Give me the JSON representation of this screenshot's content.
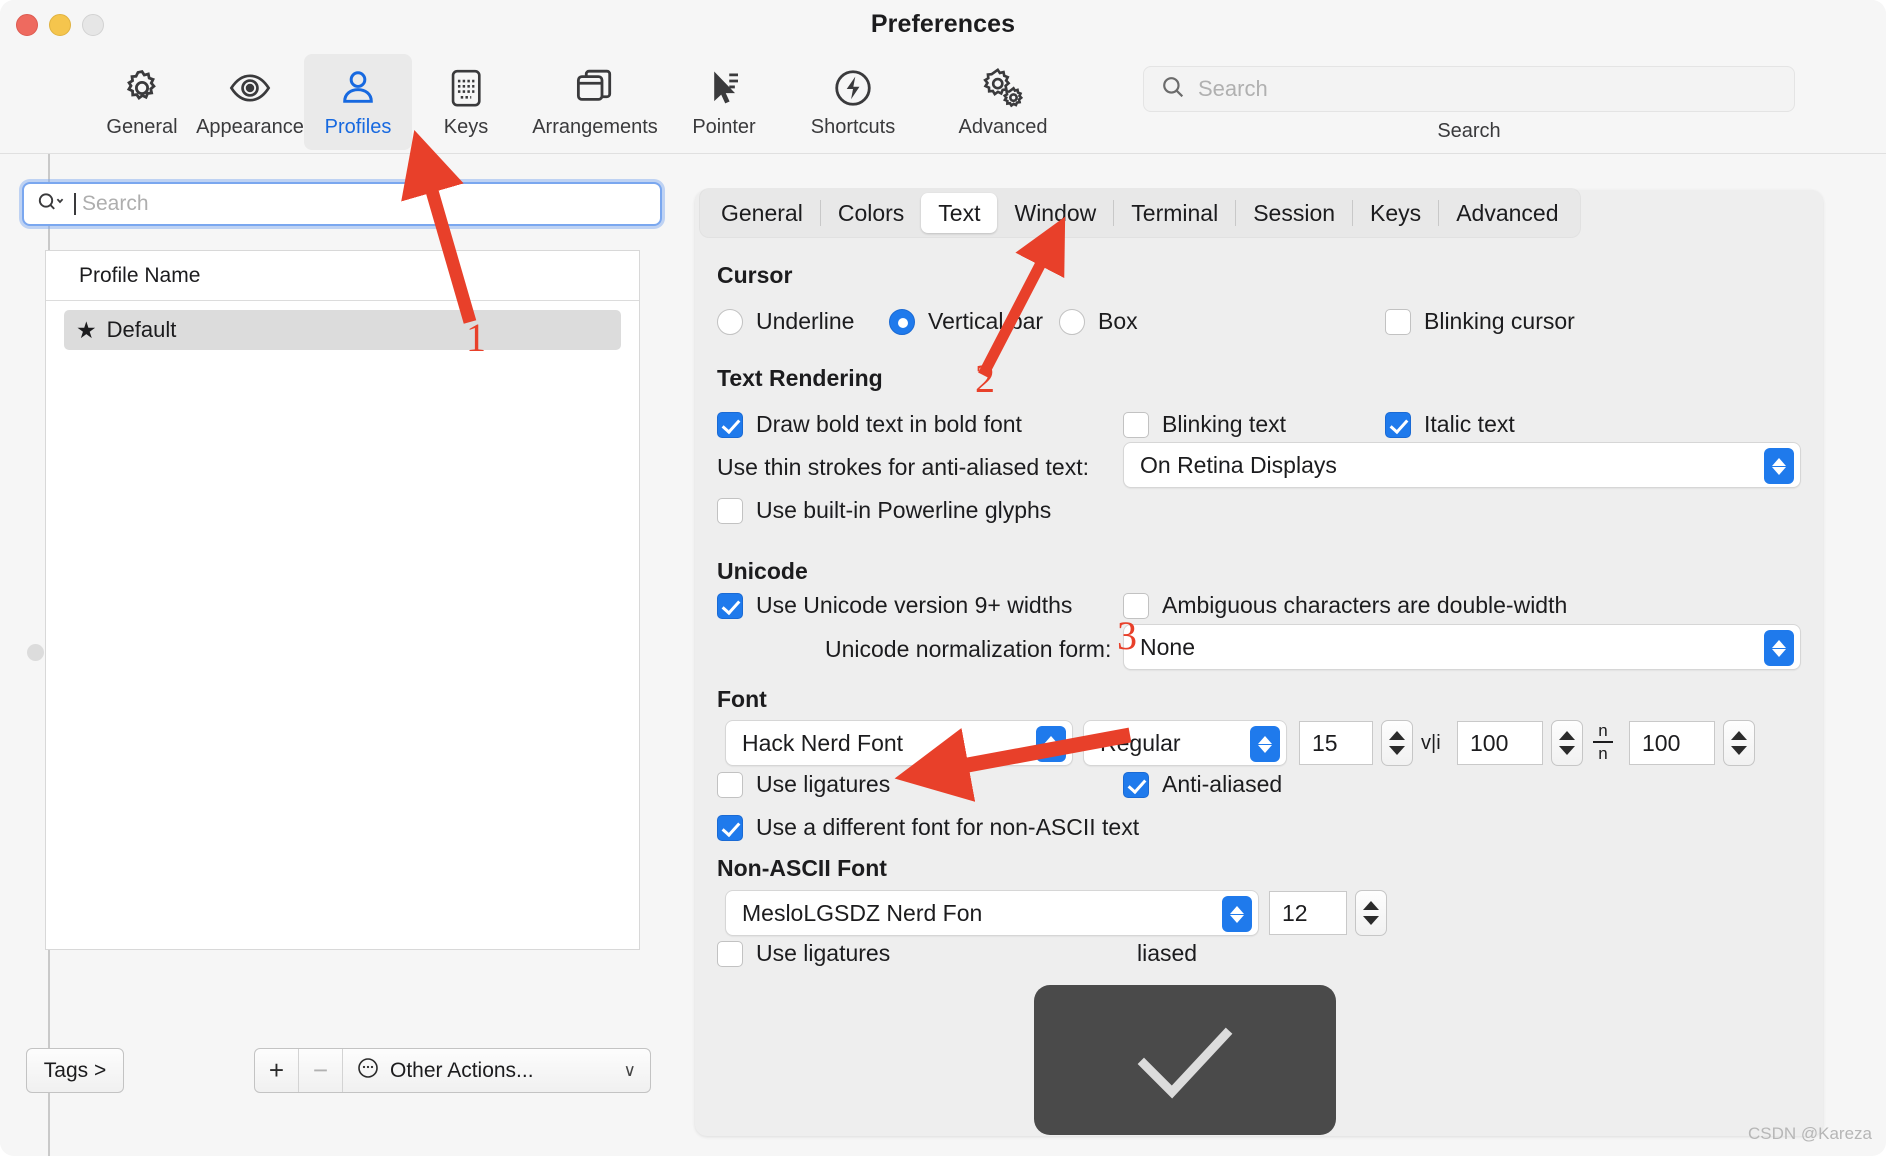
{
  "window": {
    "title": "Preferences",
    "traffic_lights": [
      "close",
      "minimize",
      "zoom"
    ]
  },
  "toolbar": {
    "items": [
      {
        "label": "General",
        "icon": "gear-icon"
      },
      {
        "label": "Appearance",
        "icon": "eye-icon"
      },
      {
        "label": "Profiles",
        "icon": "person-icon",
        "selected": true
      },
      {
        "label": "Keys",
        "icon": "keyboard-icon"
      },
      {
        "label": "Arrangements",
        "icon": "windows-icon"
      },
      {
        "label": "Pointer",
        "icon": "cursor-icon"
      },
      {
        "label": "Shortcuts",
        "icon": "bolt-icon"
      },
      {
        "label": "Advanced",
        "icon": "gears-icon"
      }
    ],
    "search": {
      "placeholder": "Search",
      "value": "",
      "label": "Search",
      "icon": "search-icon"
    }
  },
  "sidebar": {
    "search": {
      "placeholder": "Search",
      "value": "",
      "icon": "search-dropdown-icon"
    },
    "list": {
      "column_header": "Profile Name",
      "rows": [
        {
          "name": "Default",
          "starred": true,
          "selected": true
        }
      ]
    },
    "footer": {
      "tags_label": "Tags >",
      "add_label": "+",
      "remove_label": "−",
      "other_actions_label": "Other Actions...",
      "other_actions_icon": "ellipsis-circle-icon",
      "chevron": "∨"
    }
  },
  "tabs": [
    {
      "label": "General",
      "active": false
    },
    {
      "label": "Colors",
      "active": false
    },
    {
      "label": "Text",
      "active": true
    },
    {
      "label": "Window",
      "active": false
    },
    {
      "label": "Terminal",
      "active": false
    },
    {
      "label": "Session",
      "active": false
    },
    {
      "label": "Keys",
      "active": false
    },
    {
      "label": "Advanced",
      "active": false
    }
  ],
  "text_pane": {
    "cursor": {
      "heading": "Cursor",
      "options": [
        {
          "label": "Underline",
          "selected": false
        },
        {
          "label": "Vertical bar",
          "selected": true
        },
        {
          "label": "Box",
          "selected": false
        }
      ],
      "blinking_cursor": {
        "label": "Blinking cursor",
        "checked": false
      }
    },
    "text_rendering": {
      "heading": "Text Rendering",
      "draw_bold": {
        "label": "Draw bold text in bold font",
        "checked": true
      },
      "blinking_text": {
        "label": "Blinking text",
        "checked": false
      },
      "italic_text": {
        "label": "Italic text",
        "checked": true
      },
      "thin_strokes_label": "Use thin strokes for anti-aliased text:",
      "thin_strokes_value": "On Retina Displays",
      "powerline": {
        "label": "Use built-in Powerline glyphs",
        "checked": false
      }
    },
    "unicode": {
      "heading": "Unicode",
      "version9": {
        "label": "Use Unicode version 9+ widths",
        "checked": true
      },
      "ambiguous": {
        "label": "Ambiguous characters are double-width",
        "checked": false
      },
      "normalization_label": "Unicode normalization form:",
      "normalization_value": "None"
    },
    "font": {
      "heading": "Font",
      "family": "Hack Nerd Font",
      "weight": "Regular",
      "size": "15",
      "horizontal_spacing_icon": "v|i",
      "horizontal_spacing": "100",
      "vertical_spacing_icon": "n/n",
      "vertical_spacing": "100",
      "ligatures": {
        "label": "Use ligatures",
        "checked": false
      },
      "antialiased": {
        "label": "Anti-aliased",
        "checked": true
      },
      "different_nonascii": {
        "label": "Use a different font for non-ASCII text",
        "checked": true
      }
    },
    "nonascii_font": {
      "heading": "Non-ASCII Font",
      "family": "MesloLGSDZ Nerd Fon",
      "size": "12",
      "ligatures": {
        "label": "Use ligatures",
        "checked": false
      },
      "antialiased": {
        "label": "liased",
        "checked": true
      }
    }
  },
  "annotations": [
    {
      "number": "1",
      "target": "profiles-toolbar-item"
    },
    {
      "number": "2",
      "target": "text-tab"
    },
    {
      "number": "3",
      "target": "font-family-popup"
    }
  ],
  "hud": {
    "icon": "checkmark-icon"
  },
  "watermark": "CSDN @Kareza",
  "colors": {
    "accent_blue": "#1f7aec",
    "selected_tool_text": "#1769e0",
    "annotation_red": "#e8402a",
    "window_bg": "#f6f6f6",
    "pane_bg": "#eeeeee",
    "hud_bg": "#4a4a4a"
  }
}
